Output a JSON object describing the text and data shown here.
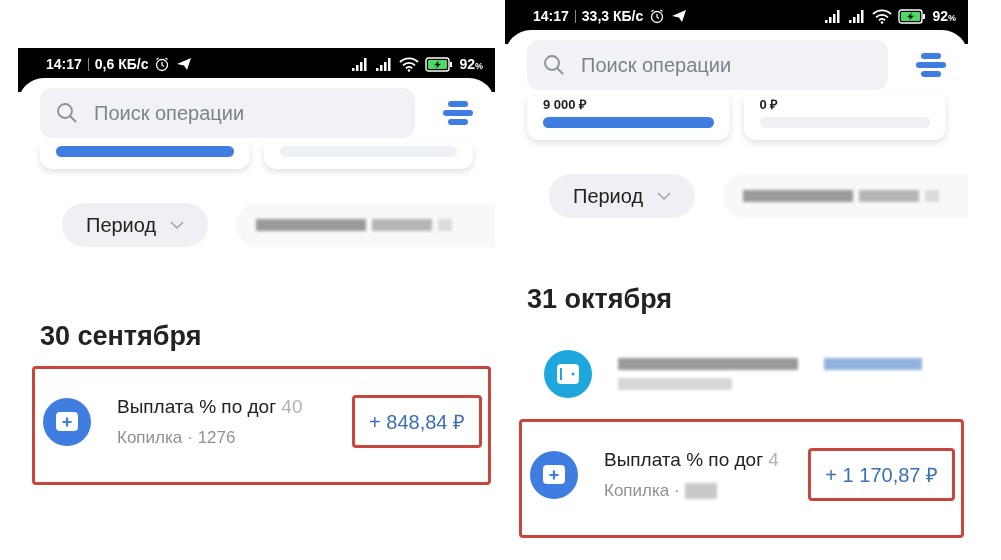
{
  "panels": [
    {
      "status_bar": {
        "time": "14:17",
        "speed": "0,6 КБ/с",
        "battery": "92",
        "battery_unit": "%"
      },
      "search": {
        "placeholder": "Поиск операции"
      },
      "cards": [
        {
          "kind": "filled",
          "level": 1
        },
        {
          "kind": "empty"
        }
      ],
      "filters": [
        {
          "kind": "chip",
          "label": "Период"
        },
        {
          "kind": "redacted"
        }
      ],
      "date": "30 сентября",
      "transactions": [
        {
          "kind": "savings",
          "title": "Выплата % по дог",
          "title_faded": "40",
          "subtitle": "Копилка",
          "subtitle_tail": "· 1276",
          "highlighted": true,
          "amount": "+ 848,84 ₽",
          "amount_highlighted": true
        }
      ]
    },
    {
      "status_bar": {
        "time": "14:17",
        "speed": "33,3 КБ/с",
        "battery": "92",
        "battery_unit": "%"
      },
      "search": {
        "placeholder": "Поиск операции"
      },
      "cards": [
        {
          "kind": "filled",
          "amount": "9 000 ₽",
          "level": 1
        },
        {
          "kind": "empty",
          "amount": "0 ₽"
        }
      ],
      "filters": [
        {
          "kind": "chip",
          "label": "Период"
        },
        {
          "kind": "redacted"
        }
      ],
      "date": "31 октября",
      "transactions": [
        {
          "kind": "redacted"
        },
        {
          "kind": "savings",
          "title": "Выплата % по дог",
          "title_faded": "4",
          "subtitle": "Копилка ·",
          "subtitle_tail_redacted": true,
          "highlighted": true,
          "amount": "+ 1 170,87 ₽",
          "amount_highlighted": true
        }
      ]
    }
  ]
}
